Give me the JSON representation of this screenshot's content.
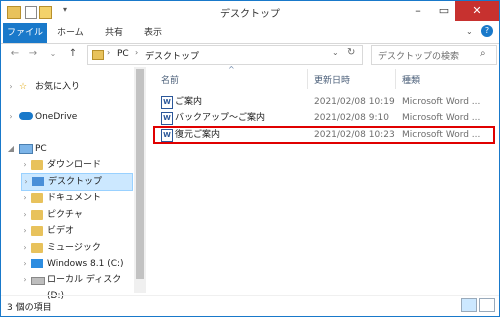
{
  "window": {
    "title": "デスクトップ"
  },
  "titlebar": {
    "minimize_icon": "minimize-icon",
    "maximize_icon": "maximize-icon",
    "close_icon": "close-icon"
  },
  "ribbon": {
    "tabs": [
      {
        "label": "ファイル"
      },
      {
        "label": "ホーム"
      },
      {
        "label": "共有"
      },
      {
        "label": "表示"
      }
    ]
  },
  "address": {
    "path": [
      {
        "label": "PC"
      },
      {
        "label": "デスクトップ"
      }
    ]
  },
  "search": {
    "placeholder": "デスクトップの検索"
  },
  "nav": {
    "items": [
      {
        "label": "お気に入り"
      },
      {
        "label": "OneDrive"
      },
      {
        "label": "PC"
      },
      {
        "label": "ダウンロード"
      },
      {
        "label": "デスクトップ"
      },
      {
        "label": "ドキュメント"
      },
      {
        "label": "ピクチャ"
      },
      {
        "label": "ビデオ"
      },
      {
        "label": "ミュージック"
      },
      {
        "label": "Windows 8.1 (C:)"
      },
      {
        "label": "ローカル ディスク (D:)"
      }
    ]
  },
  "list": {
    "columns": [
      {
        "label": "名前"
      },
      {
        "label": "更新日時"
      },
      {
        "label": "種類"
      }
    ],
    "rows": [
      {
        "name": "ご案内",
        "date": "2021/02/08 10:19",
        "type": "Microsoft Word ..."
      },
      {
        "name": "バックアップ〜ご案内",
        "date": "2021/02/08 9:10",
        "type": "Microsoft Word ..."
      },
      {
        "name": "復元ご案内",
        "date": "2021/02/08 10:23",
        "type": "Microsoft Word ..."
      }
    ]
  },
  "status": {
    "text": "3 個の項目"
  },
  "colors": {
    "accent": "#1979ca",
    "highlight": "#e00000",
    "selection": "#cce8ff"
  }
}
